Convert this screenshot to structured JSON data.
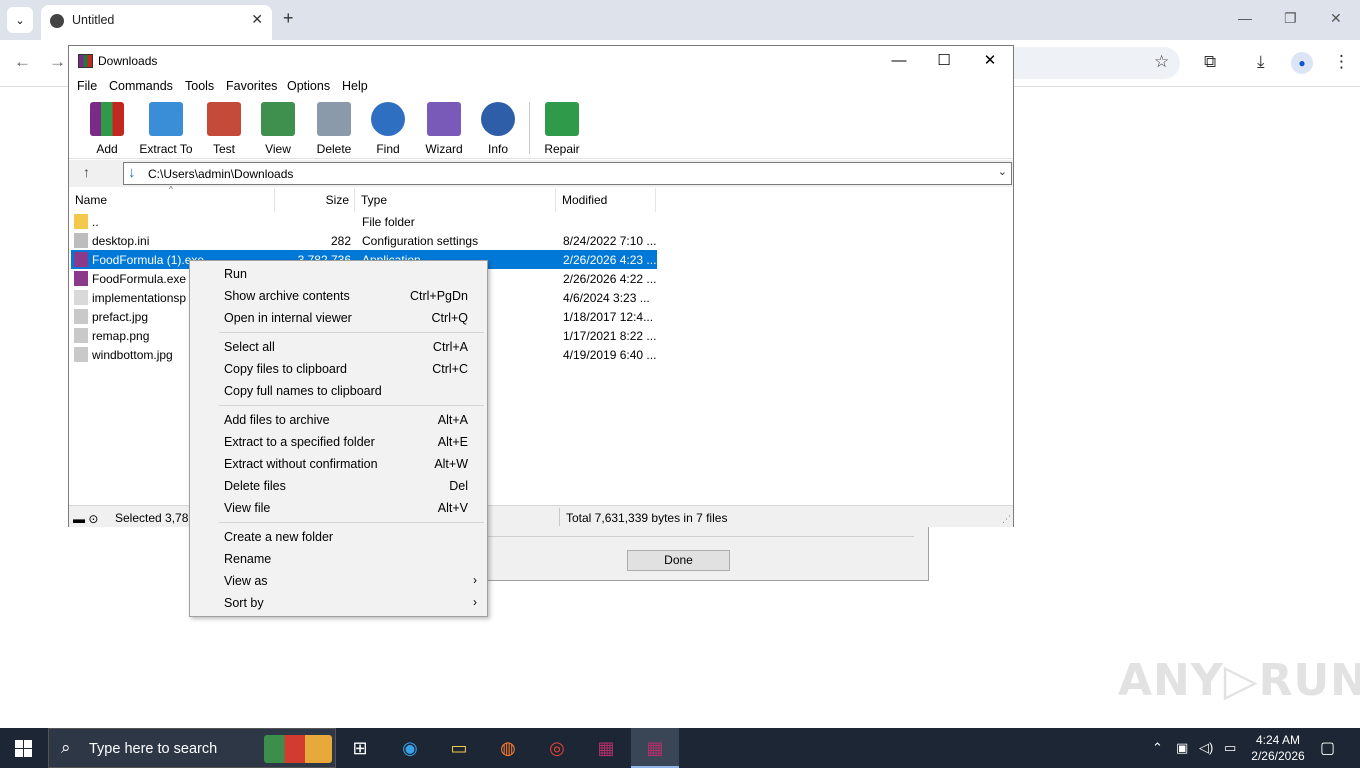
{
  "browser": {
    "tab_title": "Untitled",
    "new_tab": "+",
    "tab_close": "✕",
    "minimize": "—",
    "restore": "❐",
    "close": "✕",
    "back": "←",
    "forward": "→",
    "bookmark": "☆",
    "extensions": "⧉",
    "downloads": "⤓",
    "menu": "⋮"
  },
  "winrar": {
    "title": "Downloads",
    "menu": [
      "File",
      "Commands",
      "Tools",
      "Favorites",
      "Options",
      "Help"
    ],
    "toolbar": [
      {
        "label": "Add",
        "icon": "add-archive-icon",
        "color": "#b8322a"
      },
      {
        "label": "Extract To",
        "icon": "extract-folder-icon",
        "color": "#3a8ed8"
      },
      {
        "label": "Test",
        "icon": "test-clipboard-icon",
        "color": "#c44a3a"
      },
      {
        "label": "View",
        "icon": "view-book-icon",
        "color": "#3f8f4f"
      },
      {
        "label": "Delete",
        "icon": "trash-icon",
        "color": "#8a9aab"
      },
      {
        "label": "Find",
        "icon": "magnifier-icon",
        "color": "#2f6fc2"
      },
      {
        "label": "Wizard",
        "icon": "wand-icon",
        "color": "#7a5ab8"
      },
      {
        "label": "Info",
        "icon": "info-icon",
        "color": "#2f5ea8"
      },
      {
        "label": "Repair",
        "icon": "repair-book-icon",
        "color": "#2f9a4a"
      }
    ],
    "path": "C:\\Users\\admin\\Downloads",
    "columns": {
      "name": "Name",
      "size": "Size",
      "type": "Type",
      "modified": "Modified"
    },
    "files": [
      {
        "name": "..",
        "size": "",
        "type": "File folder",
        "modified": "",
        "icon": "folder-icon",
        "selected": false
      },
      {
        "name": "desktop.ini",
        "size": "282",
        "type": "Configuration settings",
        "modified": "8/24/2022 7:10 ...",
        "icon": "settings-file-icon",
        "selected": false
      },
      {
        "name": "FoodFormula (1).exe",
        "size": "3,782,736",
        "type": "Application",
        "modified": "2/26/2026 4:23 ...",
        "icon": "winrar-exe-icon",
        "selected": true
      },
      {
        "name": "FoodFormula.exe",
        "size": "",
        "type": "",
        "modified": "2/26/2026 4:22 ...",
        "icon": "winrar-exe-icon",
        "selected": false
      },
      {
        "name": "implementationsp",
        "size": "",
        "type": "",
        "modified": "4/6/2024 3:23 ...",
        "icon": "file-icon",
        "selected": false
      },
      {
        "name": "prefact.jpg",
        "size": "",
        "type": "",
        "modified": "1/18/2017 12:4...",
        "icon": "image-file-icon",
        "selected": false
      },
      {
        "name": "remap.png",
        "size": "",
        "type": "",
        "modified": "1/17/2021 8:22 ...",
        "icon": "image-file-icon",
        "selected": false
      },
      {
        "name": "windbottom.jpg",
        "size": "",
        "type": "",
        "modified": "4/19/2019 6:40 ...",
        "icon": "image-file-icon",
        "selected": false
      }
    ],
    "status_left": "Selected 3,782",
    "status_right": "Total 7,631,339 bytes in 7 files"
  },
  "context_menu": {
    "groups": [
      [
        {
          "label": "Run",
          "shortcut": ""
        },
        {
          "label": "Show archive contents",
          "shortcut": "Ctrl+PgDn"
        },
        {
          "label": "Open in internal viewer",
          "shortcut": "Ctrl+Q"
        }
      ],
      [
        {
          "label": "Select all",
          "shortcut": "Ctrl+A"
        },
        {
          "label": "Copy files to clipboard",
          "shortcut": "Ctrl+C"
        },
        {
          "label": "Copy full names to clipboard",
          "shortcut": ""
        }
      ],
      [
        {
          "label": "Add files to archive",
          "shortcut": "Alt+A"
        },
        {
          "label": "Extract to a specified folder",
          "shortcut": "Alt+E"
        },
        {
          "label": "Extract without confirmation",
          "shortcut": "Alt+W"
        },
        {
          "label": "Delete files",
          "shortcut": "Del"
        },
        {
          "label": "View file",
          "shortcut": "Alt+V"
        }
      ],
      [
        {
          "label": "Create a new folder",
          "shortcut": ""
        },
        {
          "label": "Rename",
          "shortcut": ""
        },
        {
          "label": "View as",
          "shortcut": "",
          "submenu": true
        },
        {
          "label": "Sort by",
          "shortcut": "",
          "submenu": true
        }
      ]
    ]
  },
  "background_dialog": {
    "done_label": "Done"
  },
  "watermark": "ANY▷RUN",
  "taskbar": {
    "search_placeholder": "Type here to search",
    "apps": [
      {
        "name": "task-view",
        "glyph": "⊞"
      },
      {
        "name": "edge",
        "glyph": "◉"
      },
      {
        "name": "file-explorer",
        "glyph": "▭"
      },
      {
        "name": "firefox",
        "glyph": "◍"
      },
      {
        "name": "chrome",
        "glyph": "◎"
      },
      {
        "name": "winrar",
        "glyph": "▦"
      },
      {
        "name": "winrar-active",
        "glyph": "▦"
      }
    ],
    "time": "4:24 AM",
    "date": "2/26/2026"
  }
}
